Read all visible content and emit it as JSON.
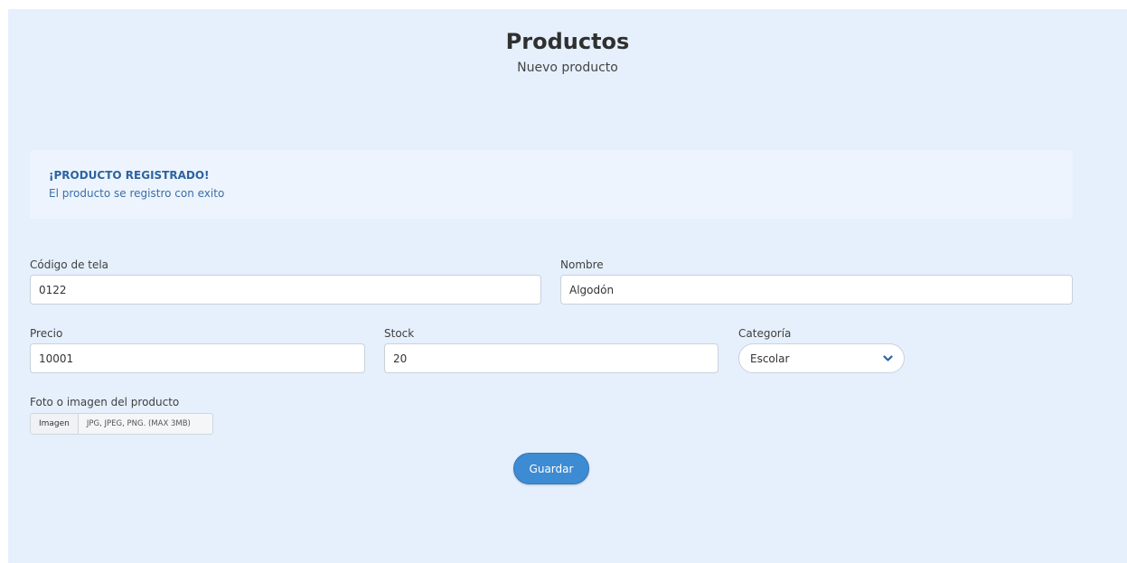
{
  "header": {
    "title": "Productos",
    "subtitle": "Nuevo producto"
  },
  "alert": {
    "title": "¡PRODUCTO REGISTRADO!",
    "message": "El producto se registro con exito",
    "color": "#2c63a0"
  },
  "form": {
    "codigo": {
      "label": "Código de tela",
      "value": "0122"
    },
    "nombre": {
      "label": "Nombre",
      "value": "Algodón"
    },
    "precio": {
      "label": "Precio",
      "value": "10001"
    },
    "stock": {
      "label": "Stock",
      "value": "20"
    },
    "categoria": {
      "label": "Categoría",
      "value": "Escolar",
      "icon": "chevron-down-icon"
    },
    "foto": {
      "label": "Foto o imagen del producto",
      "button_label": "Imagen",
      "hint": "JPG, JPEG, PNG. (MAX 3MB)"
    },
    "save_label": "Guardar"
  },
  "colors": {
    "background": "#e6f0fd",
    "accent": "#3d8bd3"
  }
}
